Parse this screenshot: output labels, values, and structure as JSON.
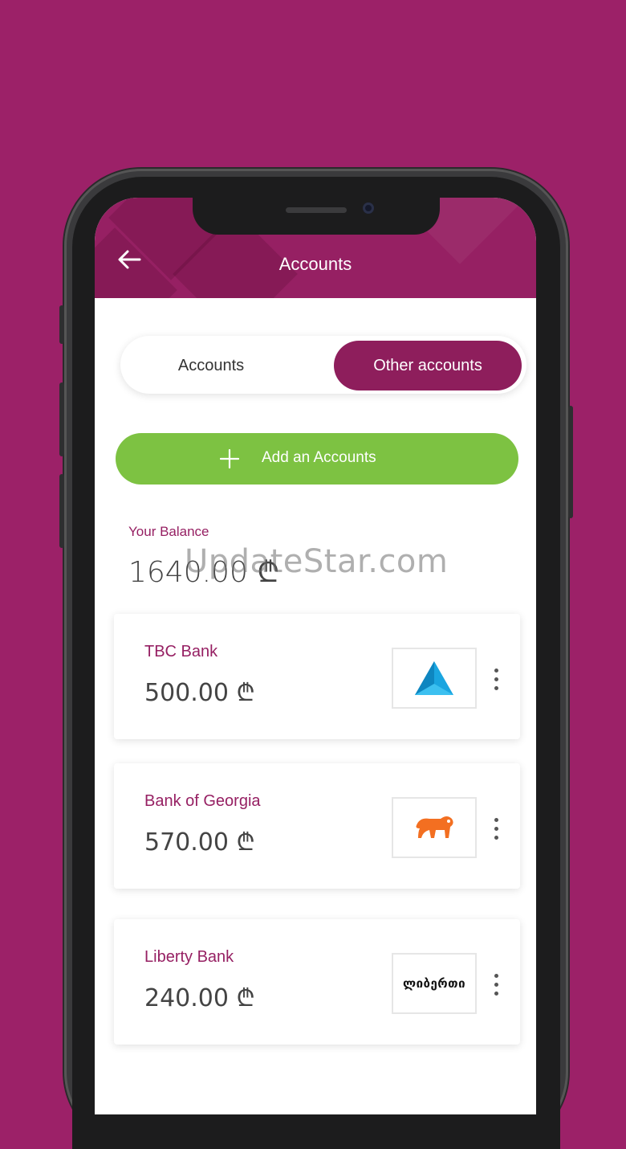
{
  "header": {
    "title": "Accounts"
  },
  "tabs": [
    {
      "label": "Accounts",
      "active": false
    },
    {
      "label": "Other accounts",
      "active": true
    }
  ],
  "add_button": {
    "label": "Add an Accounts"
  },
  "balance": {
    "label": "Your Balance",
    "value": "1640.00 ₾"
  },
  "watermark": "UpdateStar.com",
  "accounts": [
    {
      "name": "TBC Bank",
      "amount": "500.00 ₾",
      "logo": "tbc-triangle-logo"
    },
    {
      "name": "Bank of Georgia",
      "amount": "570.00 ₾",
      "logo": "lion-logo"
    },
    {
      "name": "Liberty Bank",
      "amount": "240.00 ₾",
      "logo": "liberty-logo",
      "logo_text": "ლიბერთი"
    }
  ],
  "colors": {
    "background": "#9c2168",
    "brand": "#962063",
    "active_tab": "#8e1e5c",
    "add_button": "#7dc242",
    "tbc_blue": "#1aa5e0",
    "bog_orange": "#f36f21"
  }
}
